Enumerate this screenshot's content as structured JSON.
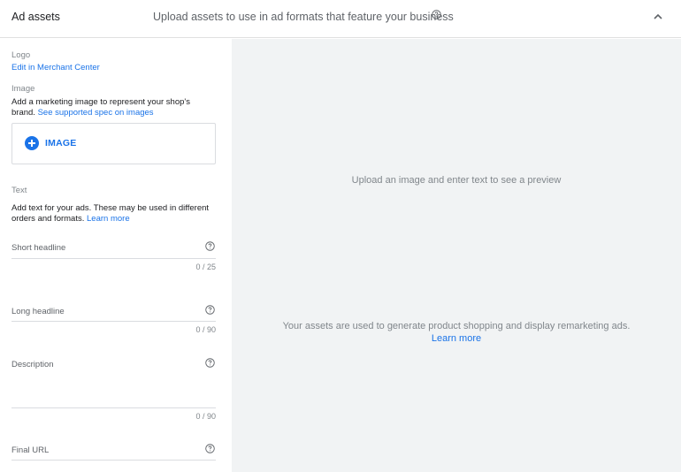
{
  "header": {
    "title": "Ad assets",
    "subtitle": "Upload assets to use in ad formats that feature your business",
    "help_icon": "help-circle-icon",
    "collapse_icon": "chevron-up-icon"
  },
  "logo": {
    "label": "Logo",
    "link": "Edit in Merchant Center"
  },
  "image": {
    "label": "Image",
    "description": "Add a marketing image to represent your shop's brand.",
    "spec_link": "See supported spec on images",
    "button_label": "IMAGE",
    "button_icon": "add-circle-icon"
  },
  "text_section": {
    "label": "Text",
    "description": "Add text for your ads. These may be used in different orders and formats.",
    "learn_more": "Learn more"
  },
  "fields": {
    "short_headline": {
      "label": "Short headline",
      "value": "",
      "counter": "0 / 25"
    },
    "long_headline": {
      "label": "Long headline",
      "value": "",
      "counter": "0 / 90"
    },
    "description": {
      "label": "Description",
      "value": "",
      "counter": "0 / 90"
    },
    "final_url": {
      "label": "Final URL",
      "value": ""
    }
  },
  "preview": {
    "placeholder": "Upload an image and enter text to see a preview",
    "assets_note": "Your assets are used to generate product shopping and display remarketing ads.",
    "learn_more": "Learn more"
  },
  "colors": {
    "accent": "#1a73e8",
    "preview_bg": "#f1f3f4",
    "muted_text": "#80868b"
  }
}
